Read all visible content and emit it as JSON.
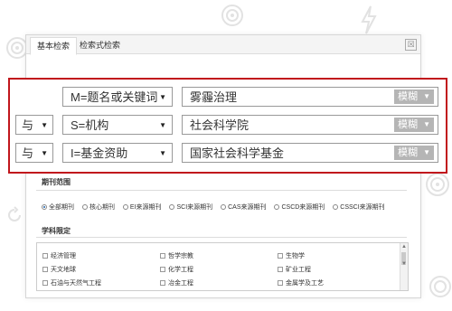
{
  "tabs": [
    {
      "label": "基本检索"
    },
    {
      "label": "检索式检索"
    }
  ],
  "close_glyph": "☒",
  "rows": [
    {
      "logic": "",
      "field": "M=题名或关键词",
      "value": "雾霾治理",
      "match": "模糊"
    },
    {
      "logic": "与",
      "field": "S=机构",
      "value": "社会科学院",
      "match": "模糊"
    },
    {
      "logic": "与",
      "field": "I=基金资助",
      "value": "国家社会科学基金",
      "match": "模糊"
    }
  ],
  "journal_scope": {
    "title": "期刊范围",
    "options": [
      "全部期刊",
      "核心期刊",
      "EI来源期刊",
      "SCI来源期刊",
      "CAS来源期刊",
      "CSCD来源期刊",
      "CSSCI来源期刊"
    ],
    "selected": "全部期刊"
  },
  "subject_limit": {
    "title": "学科限定",
    "items": [
      "经济管理",
      "哲学宗教",
      "生物学",
      "天文地球",
      "化学工程",
      "矿业工程",
      "石油与天然气工程",
      "冶金工程",
      "金属学及工艺"
    ]
  },
  "colors": {
    "accent": "#c1161c",
    "button_gray": "#b5b5b5"
  }
}
